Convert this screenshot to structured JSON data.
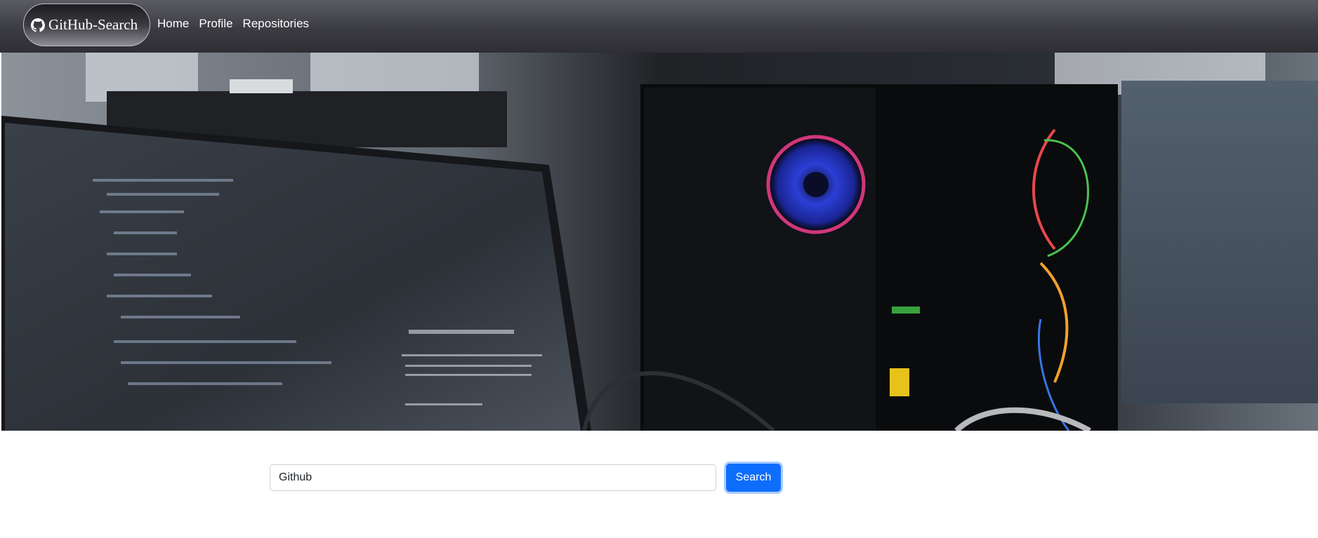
{
  "navbar": {
    "brand": {
      "label": "GitHub-Search",
      "icon": "github-icon"
    },
    "links": [
      {
        "label": "Home"
      },
      {
        "label": "Profile"
      },
      {
        "label": "Repositories"
      }
    ]
  },
  "hero": {
    "image": "workspace-photo-monitor-and-gaming-pc"
  },
  "search": {
    "value": "Github",
    "button_label": "Search"
  },
  "colors": {
    "navbar": "#3b3b42",
    "button": "#0d6efd"
  }
}
